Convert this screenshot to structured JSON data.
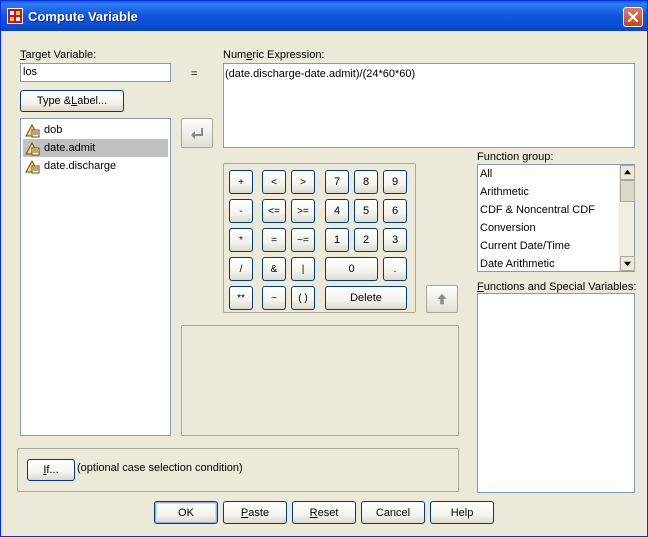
{
  "window": {
    "title": "Compute Variable"
  },
  "target_variable": {
    "label_pre": "",
    "label_u": "T",
    "label_post": "arget Variable:",
    "value": "los"
  },
  "type_label_button": {
    "pre": "Type & ",
    "u": "L",
    "post": "abel..."
  },
  "numeric_expression": {
    "label_pre": "Num",
    "label_u": "e",
    "label_post": "ric Expression:",
    "value": "(date.discharge-date.admit)/(24*60*60)"
  },
  "equals_sign": "=",
  "variables": [
    {
      "name": "dob",
      "selected": false
    },
    {
      "name": "date.admit",
      "selected": true
    },
    {
      "name": "date.discharge",
      "selected": false
    }
  ],
  "calculator": {
    "ops_col1": [
      "+",
      "-",
      "*",
      "/",
      "**"
    ],
    "ops_col2": [
      "<",
      "<=",
      "=",
      "&",
      "~"
    ],
    "ops_col3": [
      ">",
      ">=",
      "~=",
      "|",
      "( )"
    ],
    "digits_row1": [
      "7",
      "8",
      "9"
    ],
    "digits_row2": [
      "4",
      "5",
      "6"
    ],
    "digits_row3": [
      "1",
      "2",
      "3"
    ],
    "zero": "0",
    "dot": ".",
    "delete": "Delete"
  },
  "function_group": {
    "label_pre": "Function ",
    "label_u": "g",
    "label_post": "roup:",
    "items": [
      "All",
      "Arithmetic",
      "CDF & Noncentral CDF",
      "Conversion",
      "Current Date/Time",
      "Date Arithmetic"
    ]
  },
  "functions_special": {
    "label_pre": "",
    "label_u": "F",
    "label_post": "unctions and Special Variables:"
  },
  "if_section": {
    "button_pre": "",
    "button_u": "I",
    "button_post": "f...",
    "note": "(optional case selection condition)"
  },
  "footer": [
    {
      "id": "ok",
      "pre": "OK",
      "u": "",
      "post": "",
      "default": true
    },
    {
      "id": "paste",
      "pre": "",
      "u": "P",
      "post": "aste",
      "default": false
    },
    {
      "id": "reset",
      "pre": "",
      "u": "R",
      "post": "eset",
      "default": false
    },
    {
      "id": "cancel",
      "pre": "Cancel",
      "u": "",
      "post": "",
      "default": false
    },
    {
      "id": "help",
      "pre": "Help",
      "u": "",
      "post": "",
      "default": false
    }
  ],
  "colors": {
    "titlebar": "#0b4fd1",
    "dialog": "#ece9d8",
    "selection": "#c0c0c0",
    "border": "#7f9db9"
  }
}
